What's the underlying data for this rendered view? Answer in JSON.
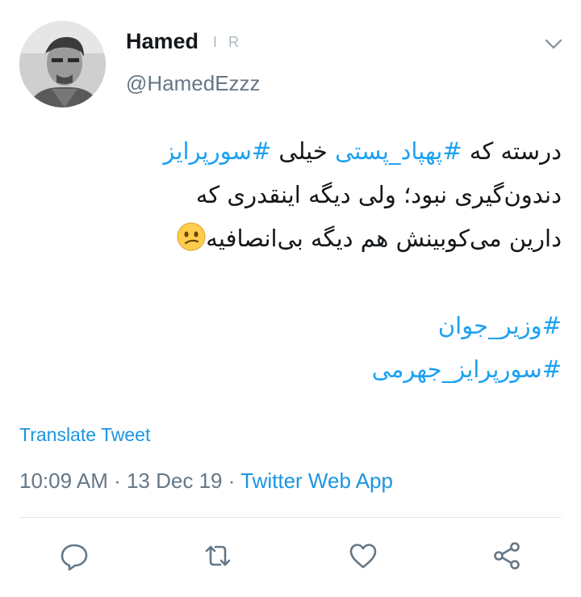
{
  "user": {
    "name": "Hamed",
    "badge_1": "I",
    "badge_2": "R",
    "handle": "@HamedEzzz"
  },
  "tweet": {
    "line1": {
      "before": "درسته که ",
      "hash1": "#پهپاد_پستی",
      "middle": " خیلی ",
      "hash2": "#سورپرایز"
    },
    "line2": "دندون‌گیری نبود؛ ولی دیگه اینقدری که",
    "line3": "دارین می‌کوبینش هم دیگه بی‌انصافیه",
    "emoji": "confused-face-icon",
    "hashtag_line1": "#وزیر_جوان",
    "hashtag_line2": "#سورپرایز_جهرمی"
  },
  "translate_label": "Translate Tweet",
  "meta": {
    "time": "10:09 AM",
    "sep1": " · ",
    "date": "13 Dec 19",
    "sep2": " · ",
    "source": "Twitter Web App"
  },
  "actions": [
    "reply-icon",
    "retweet-icon",
    "like-icon",
    "share-icon"
  ],
  "colors": {
    "link": "#1da1f2",
    "secondary": "#657786",
    "text": "#14171a",
    "icon": "#657786"
  }
}
